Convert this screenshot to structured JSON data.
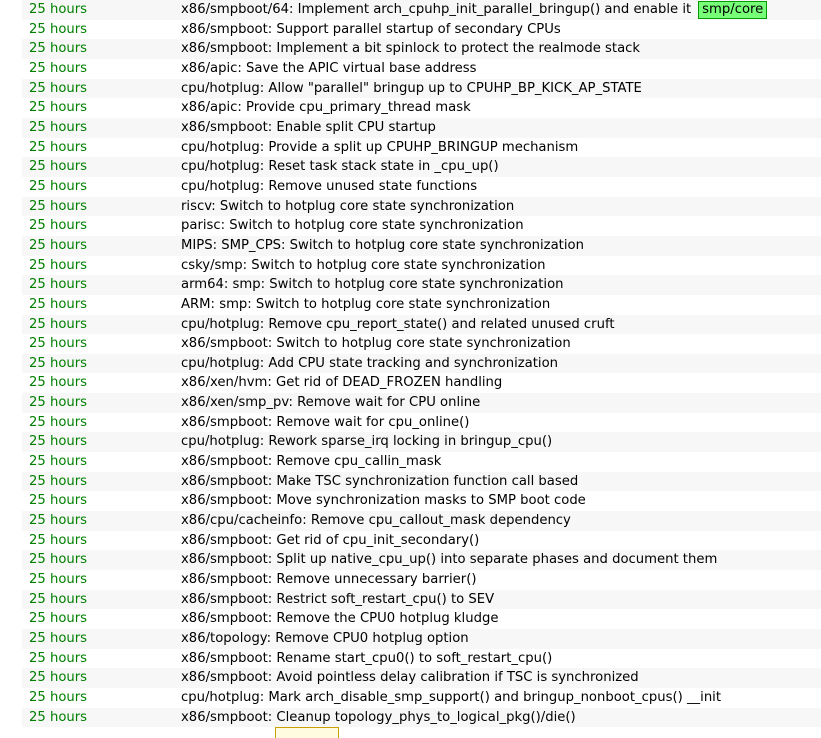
{
  "colors": {
    "age_text": "#008000",
    "row_stripe": "#f7f7f7",
    "ref_badge_bg": "#77ff77",
    "ref_badge_border": "#009900"
  },
  "log": {
    "rows": [
      {
        "age": "25 hours",
        "message": "x86/smpboot/64: Implement arch_cpuhp_init_parallel_bringup() and enable it",
        "ref": "smp/core"
      },
      {
        "age": "25 hours",
        "message": "x86/smpboot: Support parallel startup of secondary CPUs"
      },
      {
        "age": "25 hours",
        "message": "x86/smpboot: Implement a bit spinlock to protect the realmode stack"
      },
      {
        "age": "25 hours",
        "message": "x86/apic: Save the APIC virtual base address"
      },
      {
        "age": "25 hours",
        "message": "cpu/hotplug: Allow \"parallel\" bringup up to CPUHP_BP_KICK_AP_STATE"
      },
      {
        "age": "25 hours",
        "message": "x86/apic: Provide cpu_primary_thread mask"
      },
      {
        "age": "25 hours",
        "message": "x86/smpboot: Enable split CPU startup"
      },
      {
        "age": "25 hours",
        "message": "cpu/hotplug: Provide a split up CPUHP_BRINGUP mechanism"
      },
      {
        "age": "25 hours",
        "message": "cpu/hotplug: Reset task stack state in _cpu_up()"
      },
      {
        "age": "25 hours",
        "message": "cpu/hotplug: Remove unused state functions"
      },
      {
        "age": "25 hours",
        "message": "riscv: Switch to hotplug core state synchronization"
      },
      {
        "age": "25 hours",
        "message": "parisc: Switch to hotplug core state synchronization"
      },
      {
        "age": "25 hours",
        "message": "MIPS: SMP_CPS: Switch to hotplug core state synchronization"
      },
      {
        "age": "25 hours",
        "message": "csky/smp: Switch to hotplug core state synchronization"
      },
      {
        "age": "25 hours",
        "message": "arm64: smp: Switch to hotplug core state synchronization"
      },
      {
        "age": "25 hours",
        "message": "ARM: smp: Switch to hotplug core state synchronization"
      },
      {
        "age": "25 hours",
        "message": "cpu/hotplug: Remove cpu_report_state() and related unused cruft"
      },
      {
        "age": "25 hours",
        "message": "x86/smpboot: Switch to hotplug core state synchronization"
      },
      {
        "age": "25 hours",
        "message": "cpu/hotplug: Add CPU state tracking and synchronization"
      },
      {
        "age": "25 hours",
        "message": "x86/xen/hvm: Get rid of DEAD_FROZEN handling"
      },
      {
        "age": "25 hours",
        "message": "x86/xen/smp_pv: Remove wait for CPU online"
      },
      {
        "age": "25 hours",
        "message": "x86/smpboot: Remove wait for cpu_online()"
      },
      {
        "age": "25 hours",
        "message": "cpu/hotplug: Rework sparse_irq locking in bringup_cpu()"
      },
      {
        "age": "25 hours",
        "message": "x86/smpboot: Remove cpu_callin_mask"
      },
      {
        "age": "25 hours",
        "message": "x86/smpboot: Make TSC synchronization function call based"
      },
      {
        "age": "25 hours",
        "message": "x86/smpboot: Move synchronization masks to SMP boot code"
      },
      {
        "age": "25 hours",
        "message": "x86/cpu/cacheinfo: Remove cpu_callout_mask dependency"
      },
      {
        "age": "25 hours",
        "message": "x86/smpboot: Get rid of cpu_init_secondary()"
      },
      {
        "age": "25 hours",
        "message": "x86/smpboot: Split up native_cpu_up() into separate phases and document them"
      },
      {
        "age": "25 hours",
        "message": "x86/smpboot: Remove unnecessary barrier()"
      },
      {
        "age": "25 hours",
        "message": "x86/smpboot: Restrict soft_restart_cpu() to SEV"
      },
      {
        "age": "25 hours",
        "message": "x86/smpboot: Remove the CPU0 hotplug kludge"
      },
      {
        "age": "25 hours",
        "message": "x86/topology: Remove CPU0 hotplug option"
      },
      {
        "age": "25 hours",
        "message": "x86/smpboot: Rename start_cpu0() to soft_restart_cpu()"
      },
      {
        "age": "25 hours",
        "message": "x86/smpboot: Avoid pointless delay calibration if TSC is synchronized"
      },
      {
        "age": "25 hours",
        "message": "cpu/hotplug: Mark arch_disable_smp_support() and bringup_nonboot_cpus() __init"
      },
      {
        "age": "25 hours",
        "message": "x86/smpboot: Cleanup topology_phys_to_logical_pkg()/die()"
      }
    ]
  }
}
